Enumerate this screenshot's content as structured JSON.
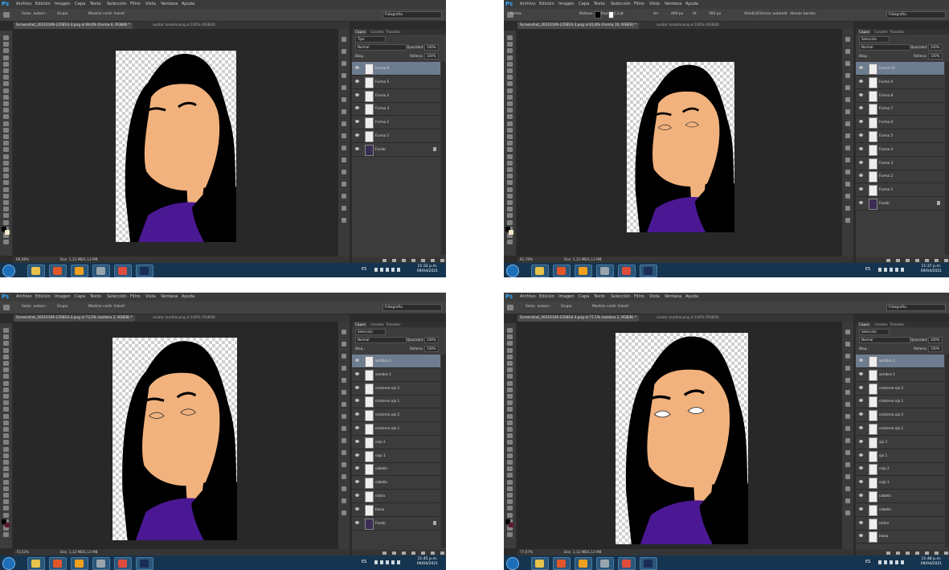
{
  "menu": [
    "Archivo",
    "Edición",
    "Imagen",
    "Capa",
    "Texto",
    "Selección",
    "Filtro",
    "Vista",
    "Ventana",
    "Ayuda"
  ],
  "app_logo": "Ps",
  "workspace": "Fotografía",
  "colors": {
    "skin": "#f2b27d",
    "hair": "#000000",
    "shirt": "#4b1893",
    "selected_layer": "#6e7c90",
    "taskbar": "#15344f",
    "ps_blue": "#31a8ff"
  },
  "taskbar_icons": [
    "windows-start-icon",
    "file-explorer-icon",
    "brave-browser-icon",
    "media-player-icon",
    "disk-icon",
    "chrome-icon",
    "photoshop-icon"
  ],
  "shots": [
    {
      "options_text": [
        "Selec. autom.:",
        "Grupo",
        "Mostrar contr. transf."
      ],
      "tabs": [
        "Screenshot_20210106-235814-3.png al 69,6% (Forma 6, RGB/8) *",
        "avatar modelo.png al 100% (RGB/8)"
      ],
      "panel_tabs": [
        "Capas",
        "Canales",
        "Trazados"
      ],
      "filter_label": "Tipo",
      "blend_mode": "Normal",
      "opacity_label": "Opacidad:",
      "opacity": "100%",
      "lock_label": "Bloq.:",
      "fill_label": "Relleno:",
      "fill": "100%",
      "layers": [
        "Forma 6",
        "Forma 5",
        "Forma 4",
        "Forma 3",
        "Forma 2",
        "Forma 1",
        "Fondo"
      ],
      "selected_layer": 0,
      "zoom": "69,58%",
      "doc_info": "Doc: 1,12 MB/1,13 MB",
      "lang": "ES",
      "time": "11:32 p.m.",
      "date": "09/04/2021"
    },
    {
      "options_text": [
        "Forma",
        "Relleno:",
        "Trazo:",
        "3,3 pt",
        "An:",
        "409 px",
        "Al:",
        "585 px",
        "Añadir/Eliminar automát.",
        "Alinear bordes"
      ],
      "tabs": [
        "Screenshot_20210106-235814-3.png al 61,8% (Forma 10, RGB/8) *",
        "avatar modelo.png al 100% (RGB/8)"
      ],
      "panel_tabs": [
        "Capas",
        "Canales",
        "Trazados"
      ],
      "filter_label": "Selección",
      "blend_mode": "Normal",
      "opacity_label": "Opacidad:",
      "opacity": "100%",
      "lock_label": "Bloq.:",
      "fill_label": "Relleno:",
      "fill": "100%",
      "layers": [
        "Forma 10",
        "Forma 9",
        "Forma 8",
        "Forma 7",
        "Forma 6",
        "Forma 5",
        "Forma 4",
        "Forma 3",
        "Forma 2",
        "Forma 1",
        "Fondo"
      ],
      "selected_layer": 0,
      "zoom": "61,78%",
      "doc_info": "Doc: 1,12 MB/1,13 MB",
      "lang": "ES",
      "time": "11:37 p.m.",
      "date": "09/04/2021"
    },
    {
      "options_text": [
        "Selec. autom.:",
        "Grupo",
        "Mostrar contr. transf."
      ],
      "tabs": [
        "Screenshot_20210106-235814-3.png al 73,5% (sombra 2, RGB/8) *",
        "avatar modelo.png al 100% (RGB/8)"
      ],
      "panel_tabs": [
        "Capas",
        "Canales",
        "Trazados"
      ],
      "filter_label": "Selección",
      "blend_mode": "Normal",
      "opacity_label": "Opacidad:",
      "opacity": "100%",
      "lock_label": "Bloq.:",
      "fill_label": "Relleno:",
      "fill": "100%",
      "layers": [
        "sombra 2",
        "sombra 1",
        "contorno ojo 2",
        "contorno ojo 1",
        "contorno ojo 2",
        "contorno ojo 1",
        "ceja 2",
        "ceja 1",
        "cabello",
        "cabello",
        "rostro",
        "blusa",
        "Fondo"
      ],
      "selected_layer": 0,
      "zoom": "73,52%",
      "doc_info": "Doc: 1,12 MB/1,13 MB",
      "lang": "ES",
      "time": "11:45 p.m.",
      "date": "09/04/2021"
    },
    {
      "options_text": [
        "Selec. autom.:",
        "Grupo",
        "Mostrar contr. transf."
      ],
      "tabs": [
        "Screenshot_20210106-235814-3.png al 77,1% (sombra 2, RGB/8) *",
        "avatar modelo.png al 100% (RGB/8)"
      ],
      "panel_tabs": [
        "Capas",
        "Canales",
        "Trazados"
      ],
      "filter_label": "Selección",
      "blend_mode": "Normal",
      "opacity_label": "Opacidad:",
      "opacity": "100%",
      "lock_label": "Bloq.:",
      "fill_label": "Relleno:",
      "fill": "100%",
      "layers": [
        "sombra 2",
        "sombra 1",
        "contorno ojo 2",
        "contorno ojo 1",
        "contorno ojo 2",
        "contorno ojo 1",
        "ojo 2",
        "ojo 1",
        "ceja 2",
        "ceja 1",
        "cabello",
        "cabello",
        "rostro",
        "blusa"
      ],
      "selected_layer": 0,
      "zoom": "77,07%",
      "doc_info": "Doc: 1,12 MB/1,13 MB",
      "lang": "ES",
      "time": "11:48 p.m.",
      "date": "09/04/2021"
    }
  ]
}
